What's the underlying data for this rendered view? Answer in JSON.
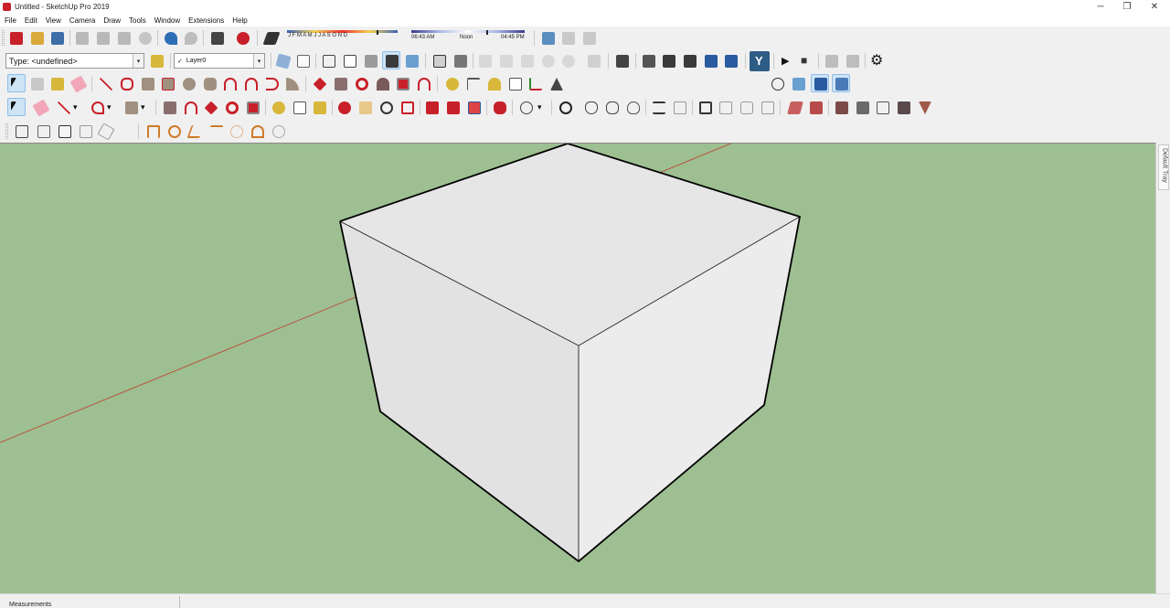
{
  "window": {
    "title": "Untitled - SketchUp Pro 2019",
    "minimize_glyph": "─",
    "restore_glyph": "❐",
    "close_glyph": "✕"
  },
  "menu": [
    "File",
    "Edit",
    "View",
    "Camera",
    "Draw",
    "Tools",
    "Window",
    "Extensions",
    "Help"
  ],
  "toolbar": {
    "entity_type": "Type: <undefined>",
    "layer": "Layer0",
    "layer_check": "✓",
    "shadow_months": "J  F  M  A  M  J  J  A  S  O  N  D",
    "time_start": "06:43 AM",
    "time_mid": "Noon",
    "time_end": "04:45 PM",
    "scene_play": "▶",
    "scene_stop": "■",
    "settings_glyph": "⚙",
    "styles_glyph": "Y",
    "dropdown_glyph": "▾"
  },
  "tray": {
    "label": "Default Tray"
  },
  "status": {
    "measurements_label": "Measurements"
  },
  "colors": {
    "ground": "#9dbf91",
    "box_top": "#e6e6e6",
    "box_left": "#e2e2e2",
    "box_right": "#ececec",
    "red_axis": "#c0392b",
    "accent": "#c8202a"
  }
}
